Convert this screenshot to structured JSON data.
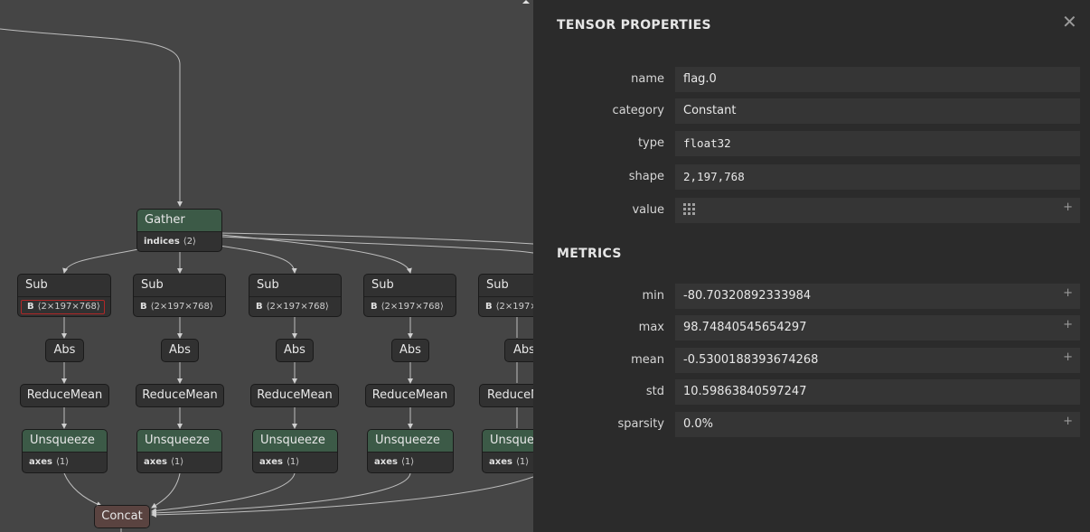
{
  "graph": {
    "gather": {
      "title": "Gather",
      "attr_name": "indices",
      "attr_value": "⟨2⟩"
    },
    "sub_nodes": [
      {
        "title": "Sub",
        "attr_name": "B",
        "attr_value": "⟨2×197×768⟩"
      },
      {
        "title": "Sub",
        "attr_name": "B",
        "attr_value": "⟨2×197×768⟩"
      },
      {
        "title": "Sub",
        "attr_name": "B",
        "attr_value": "⟨2×197×768⟩"
      },
      {
        "title": "Sub",
        "attr_name": "B",
        "attr_value": "⟨2×197×768⟩"
      },
      {
        "title": "Sub",
        "attr_name": "B",
        "attr_value": "⟨2×197×768⟩"
      }
    ],
    "abs_label": "Abs",
    "reducemean_label": "ReduceMean",
    "unsqueeze": {
      "title": "Unsqueeze",
      "attr_name": "axes",
      "attr_value": "⟨1⟩"
    },
    "concat_label": "Concat"
  },
  "panel": {
    "title": "TENSOR PROPERTIES",
    "close_icon": "✕",
    "properties": [
      {
        "label": "name",
        "value": "flag.0"
      },
      {
        "label": "category",
        "value": "Constant"
      },
      {
        "label": "type",
        "value": "float32"
      },
      {
        "label": "shape",
        "value": "2,197,768"
      },
      {
        "label": "value",
        "value": ""
      }
    ],
    "metrics_title": "METRICS",
    "metrics": [
      {
        "label": "min",
        "value": "-80.70320892333984"
      },
      {
        "label": "max",
        "value": "98.74840545654297"
      },
      {
        "label": "mean",
        "value": "-0.5300188393674268"
      },
      {
        "label": "std",
        "value": "10.59863840597247"
      },
      {
        "label": "sparsity",
        "value": "0.0%"
      }
    ],
    "expand_icon": "+",
    "value_icon": "grid-dots-icon"
  },
  "colors": {
    "graph_bg": "#454545",
    "panel_bg": "#2b2b2b",
    "node_bg": "#313131",
    "node_green": "#3c5a47",
    "node_brown": "#5a4340",
    "highlight": "#b02828"
  }
}
